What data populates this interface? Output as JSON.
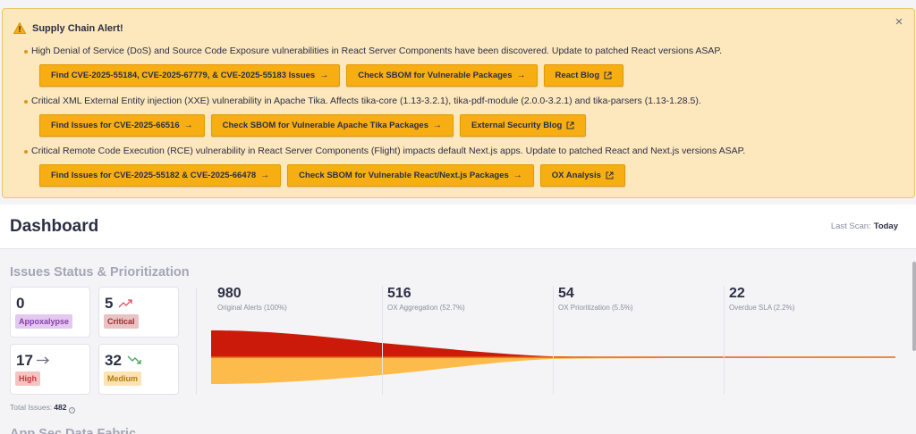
{
  "alert": {
    "title": "Supply Chain Alert!",
    "close": "×",
    "items": [
      {
        "text": "High Denial of Service (DoS) and Source Code Exposure vulnerabilities in React Server Components have been discovered. Update to patched React versions ASAP.",
        "buttons": [
          {
            "label": "Find CVE-2025-55184, CVE-2025-67779, & CVE-2025-55183 Issues",
            "icon": "arrow-right"
          },
          {
            "label": "Check SBOM for Vulnerable Packages",
            "icon": "arrow-right"
          },
          {
            "label": "React Blog",
            "icon": "external-link"
          }
        ]
      },
      {
        "text": "Critical XML External Entity injection (XXE) vulnerability in Apache Tika. Affects tika-core (1.13-3.2.1), tika-pdf-module (2.0.0-3.2.1) and tika-parsers (1.13-1.28.5).",
        "buttons": [
          {
            "label": "Find Issues for CVE-2025-66516",
            "icon": "arrow-right"
          },
          {
            "label": "Check SBOM for Vulnerable Apache Tika Packages",
            "icon": "arrow-right"
          },
          {
            "label": "External Security Blog",
            "icon": "external-link"
          }
        ]
      },
      {
        "text": "Critical Remote Code Execution (RCE) vulnerability in React Server Components (Flight) impacts default Next.js apps. Update to patched React and Next.js versions ASAP.",
        "buttons": [
          {
            "label": "Find Issues for CVE-2025-55182 & CVE-2025-66478",
            "icon": "arrow-right"
          },
          {
            "label": "Check SBOM for Vulnerable React/Next.js Packages",
            "icon": "arrow-right"
          },
          {
            "label": "OX Analysis",
            "icon": "external-link"
          }
        ]
      }
    ]
  },
  "header": {
    "title": "Dashboard",
    "last_scan_label": "Last Scan:",
    "last_scan_value": "Today"
  },
  "issues": {
    "title": "Issues Status & Prioritization",
    "cards": [
      {
        "count": "0",
        "label": "Appoxalypse",
        "trend": "",
        "badge_bg": "#e3c8f0",
        "badge_fg": "#8a3fae",
        "trend_color": ""
      },
      {
        "count": "5",
        "label": "Critical",
        "trend": "up",
        "badge_bg": "#e8c3c3",
        "badge_fg": "#9c2a2a",
        "trend_color": "#e05262"
      },
      {
        "count": "17",
        "label": "High",
        "trend": "flat",
        "badge_bg": "#f6c3c3",
        "badge_fg": "#c83737",
        "trend_color": "#8a8da0"
      },
      {
        "count": "32",
        "label": "Medium",
        "trend": "down",
        "badge_bg": "#fde3b3",
        "badge_fg": "#b07a11",
        "trend_color": "#3ea35a"
      }
    ],
    "total_label": "Total Issues:",
    "total_value": "482"
  },
  "funnel": {
    "stages": [
      {
        "value": "980",
        "label": "Original Alerts (100%)"
      },
      {
        "value": "516",
        "label": "OX Aggregation (52.7%)"
      },
      {
        "value": "54",
        "label": "OX Prioritization (5.5%)"
      },
      {
        "value": "22",
        "label": "Overdue SLA (2.2%)"
      }
    ],
    "colors": {
      "top": "#cc1a0a",
      "bottom": "#fdbb4c"
    }
  },
  "next_section": {
    "title": "App Sec Data Fabric"
  }
}
